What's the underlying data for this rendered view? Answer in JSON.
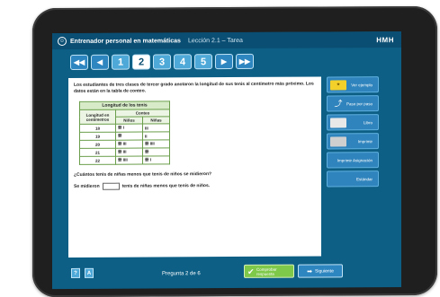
{
  "app": {
    "title": "Entrenador personal en matemáticas",
    "lesson": "Lección 2.1 – Tarea",
    "brand": "HMH"
  },
  "nav": {
    "first": "◀◀",
    "prev": "◀",
    "pages": [
      "1",
      "2",
      "3",
      "4",
      "5"
    ],
    "active_page": "2",
    "next": "▶",
    "last": "▶▶"
  },
  "content": {
    "prompt": "Los estudiantes de tres clases de tercer grado anotaron la longitud de sus tenis al centímetro más próximo. Los datos están en la tabla de conteo.",
    "table": {
      "title": "Longitud de los tenis",
      "col_length": "Longitud en centímetros",
      "col_count": "Conteo",
      "col_boys": "Niños",
      "col_girls": "Niñas",
      "rows": [
        {
          "length": "18",
          "boys": "卌 I",
          "girls": "III"
        },
        {
          "length": "19",
          "boys": "卌",
          "girls": "II"
        },
        {
          "length": "20",
          "boys": "卌 III",
          "girls": "卌 IIII"
        },
        {
          "length": "21",
          "boys": "卌 III",
          "girls": "卌"
        },
        {
          "length": "22",
          "boys": "卌 IIII",
          "girls": "卌 I"
        }
      ]
    },
    "question": "¿Cuántos tenis de niñas menos que tenis de niños se midieron?",
    "answer_prefix": "Se midieron",
    "answer_value": "",
    "answer_suffix": "tenis de niñas menos que tenis de niños."
  },
  "side": {
    "example": "Ver ejemplo",
    "step": "Paso por paso",
    "book": "Libro",
    "print": "Imprimir",
    "print_assignment": "Imprimir Asignación",
    "standard": "Estándar"
  },
  "bottom": {
    "help": "?",
    "tools": "A",
    "counter": "Pregunta 2 de 6",
    "check": "Comprobar respuesta",
    "next": "Siguiente"
  }
}
